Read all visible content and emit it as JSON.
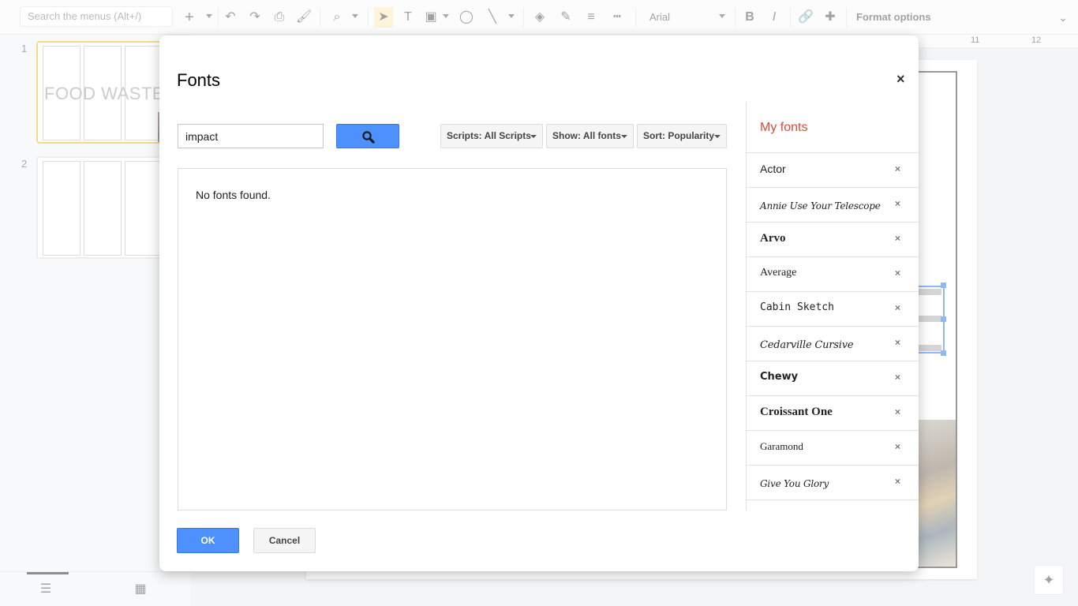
{
  "toolbar": {
    "menu_search_placeholder": "Search the menus (Alt+/)",
    "font_name": "Arial",
    "format_options_label": "Format options",
    "icons": [
      "add-icon",
      "undo-icon",
      "redo-icon",
      "print-icon",
      "paint-format-icon",
      "zoom-icon",
      "select-icon",
      "textbox-icon",
      "image-icon",
      "shape-icon",
      "line-icon",
      "fill-color-icon",
      "border-color-icon",
      "border-weight-icon",
      "border-dash-icon",
      "bold-icon",
      "italic-icon",
      "link-icon",
      "comment-icon"
    ]
  },
  "filmstrip": {
    "slides": [
      {
        "number": "1",
        "title": "FOOD WASTE"
      },
      {
        "number": "2",
        "title": ""
      }
    ]
  },
  "ruler": {
    "tick_11": "11",
    "tick_12": "12"
  },
  "dialog": {
    "title": "Fonts",
    "close_label": "×",
    "search": {
      "value": "impact"
    },
    "filters": {
      "scripts": "Scripts: All Scripts",
      "show": "Show: All fonts",
      "sort": "Sort: Popularity"
    },
    "no_results_text": "No fonts found.",
    "my_fonts": {
      "title": "My fonts",
      "remove_label": "×",
      "items": [
        {
          "name": "Actor"
        },
        {
          "name": "Annie Use Your Telescope"
        },
        {
          "name": "Arvo"
        },
        {
          "name": "Average"
        },
        {
          "name": "Cabin Sketch"
        },
        {
          "name": "Cedarville Cursive"
        },
        {
          "name": "Chewy"
        },
        {
          "name": "Croissant One"
        },
        {
          "name": "Garamond"
        },
        {
          "name": "Give You Glory"
        }
      ]
    },
    "ok_label": "OK",
    "cancel_label": "Cancel"
  },
  "colors": {
    "accent_blue": "#4d90fe",
    "my_fonts_red": "#dd4b39",
    "active_slide_border": "#f4b400"
  }
}
